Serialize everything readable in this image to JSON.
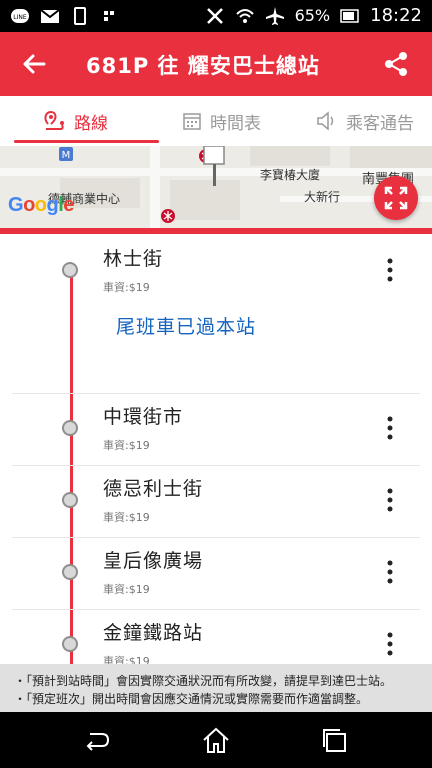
{
  "status_bar": {
    "battery": "65%",
    "time": "18:22"
  },
  "appbar": {
    "title": "681P 往 耀安巴士總站"
  },
  "tabs": [
    {
      "label": "路線",
      "icon": "route-icon",
      "active": true
    },
    {
      "label": "時間表",
      "icon": "calendar-icon",
      "active": false
    },
    {
      "label": "乘客通告",
      "icon": "speaker-icon",
      "active": false
    }
  ],
  "map": {
    "labels": [
      "李寶椿大廈",
      "大新行",
      "南豐集團",
      "德輔商業中心"
    ],
    "logo": "Google"
  },
  "stops": [
    {
      "name": "林士街",
      "fare": "車資:$19",
      "note": "尾班車已過本站"
    },
    {
      "name": "中環街市",
      "fare": "車資:$19"
    },
    {
      "name": "德忌利士街",
      "fare": "車資:$19"
    },
    {
      "name": "皇后像廣場",
      "fare": "車資:$19"
    },
    {
      "name": "金鐘鐵路站",
      "fare": "車資:$19"
    }
  ],
  "notices": [
    "・「預計到站時間」會因實際交通狀況而有所改變，請提早到達巴士站。",
    "・「預定班次」開出時間會因應交通情況或實際需要而作適當調整。"
  ],
  "colors": {
    "accent": "#e8303f",
    "link": "#1565c0"
  }
}
